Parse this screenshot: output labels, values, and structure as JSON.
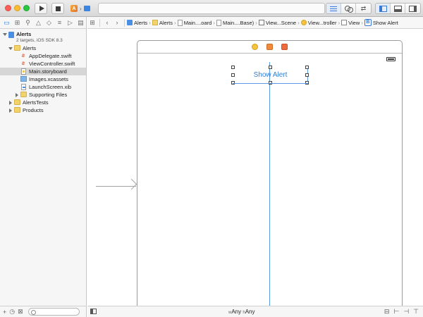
{
  "toolbar": {
    "run_label": "Run",
    "stop_label": "Stop",
    "scheme_icon": "app-scheme-icon",
    "activity_text": ""
  },
  "navigator": {
    "project": {
      "name": "Alerts",
      "subtitle": "2 targets, iOS SDK 8.3"
    },
    "items": [
      {
        "label": "Alerts",
        "type": "folder",
        "level": 1,
        "disclosure": "open"
      },
      {
        "label": "AppDelegate.swift",
        "type": "swift",
        "level": 2
      },
      {
        "label": "ViewController.swift",
        "type": "swift",
        "level": 2
      },
      {
        "label": "Main.storyboard",
        "type": "storyboard",
        "level": 2,
        "selected": true
      },
      {
        "label": "Images.xcassets",
        "type": "xcassets",
        "level": 2
      },
      {
        "label": "LaunchScreen.xib",
        "type": "xib",
        "level": 2
      },
      {
        "label": "Supporting Files",
        "type": "folder",
        "level": 2,
        "disclosure": "closed"
      },
      {
        "label": "AlertsTests",
        "type": "folder",
        "level": 1,
        "disclosure": "closed"
      },
      {
        "label": "Products",
        "type": "folder",
        "level": 1,
        "disclosure": "closed"
      }
    ]
  },
  "jumpbar": {
    "crumbs": [
      {
        "label": "Alerts",
        "icon": "project"
      },
      {
        "label": "Alerts",
        "icon": "folder"
      },
      {
        "label": "Main....oard",
        "icon": "doc"
      },
      {
        "label": "Main....Base)",
        "icon": "doc"
      },
      {
        "label": "View...Scene",
        "icon": "scene"
      },
      {
        "label": "View...troller",
        "icon": "vc"
      },
      {
        "label": "View",
        "icon": "view"
      },
      {
        "label": "Show Alert",
        "icon": "button"
      }
    ]
  },
  "canvas": {
    "button_label": "Show Alert"
  },
  "bottombar": {
    "width_prefix": "w",
    "width_value": "Any",
    "height_prefix": "h",
    "height_value": "Any"
  },
  "colors": {
    "accent": "#2f80d8",
    "guide": "#5a9be0",
    "selection_row": "#d6d6d6"
  }
}
